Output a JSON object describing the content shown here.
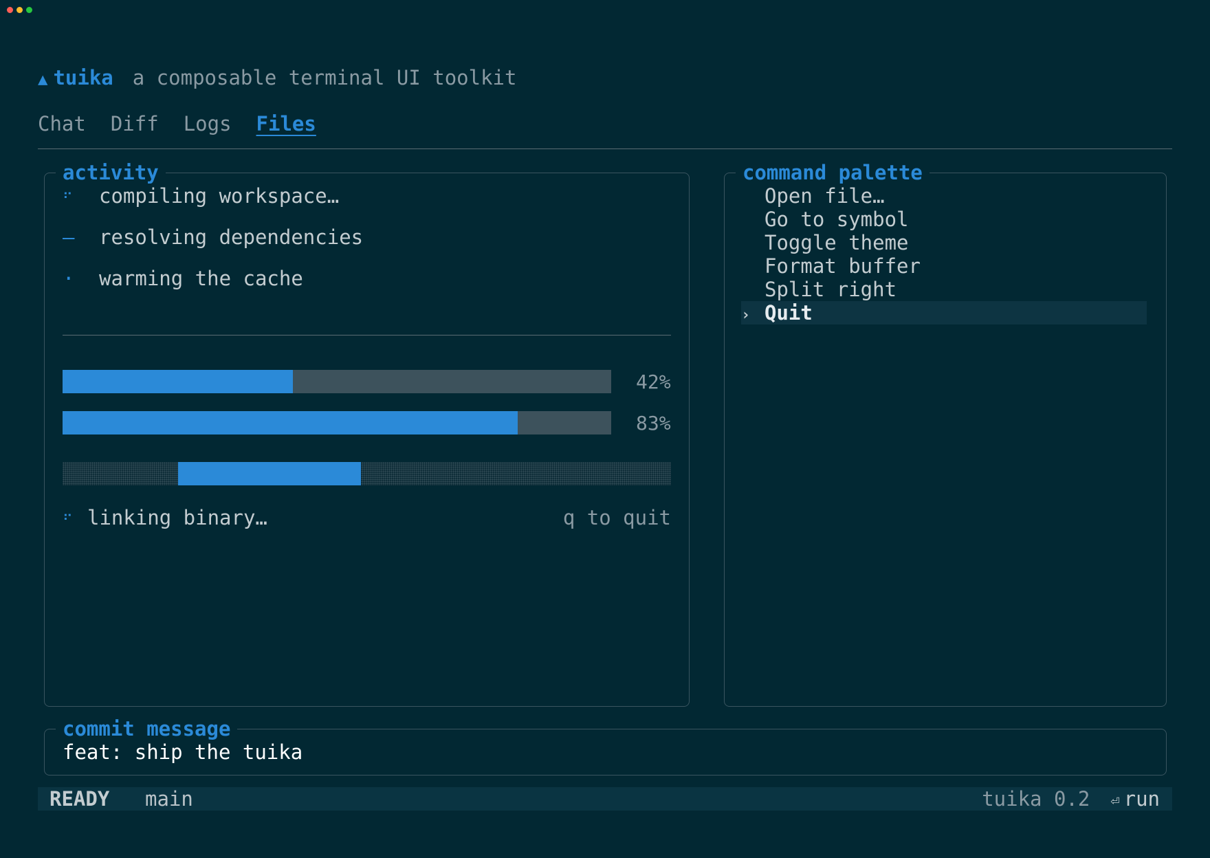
{
  "window": {
    "controls": [
      "close",
      "minimize",
      "maximize"
    ]
  },
  "header": {
    "logo_icon": "triangle-up-icon",
    "app_name": "tuika",
    "tagline": "a composable terminal UI toolkit"
  },
  "tabs": [
    {
      "label": "Chat",
      "active": false
    },
    {
      "label": "Diff",
      "active": false
    },
    {
      "label": "Logs",
      "active": false
    },
    {
      "label": "Files",
      "active": true
    }
  ],
  "activity": {
    "title": "activity",
    "tasks": [
      {
        "glyph": "⠋",
        "label": "compiling workspace…"
      },
      {
        "glyph": "—",
        "label": "resolving dependencies"
      },
      {
        "glyph": "·",
        "label": "warming the cache"
      }
    ],
    "progress": [
      {
        "value": 0.42,
        "label": "42%"
      },
      {
        "value": 0.83,
        "label": "83%"
      }
    ],
    "indeterminate": {
      "start": 0.19,
      "length": 0.3
    },
    "status": {
      "glyph": "⠋",
      "text": "linking binary…",
      "hint": "q to quit"
    }
  },
  "palette": {
    "title": "command palette",
    "items": [
      {
        "label": "Open file…",
        "selected": false
      },
      {
        "label": "Go to symbol",
        "selected": false
      },
      {
        "label": "Toggle theme",
        "selected": false
      },
      {
        "label": "Format buffer",
        "selected": false
      },
      {
        "label": "Split right",
        "selected": false
      },
      {
        "label": "Quit",
        "selected": true
      }
    ],
    "caret": "›"
  },
  "commit": {
    "title": "commit message",
    "value": "feat: ship the tuika"
  },
  "statusbar": {
    "mode": "READY",
    "branch": "main",
    "version": "tuika 0.2",
    "enter_icon": "⏎",
    "action": "run"
  },
  "colors": {
    "background": "#022833",
    "accent": "#2b8ad8",
    "track": "#3d525c",
    "muted": "#8a9aa3"
  }
}
